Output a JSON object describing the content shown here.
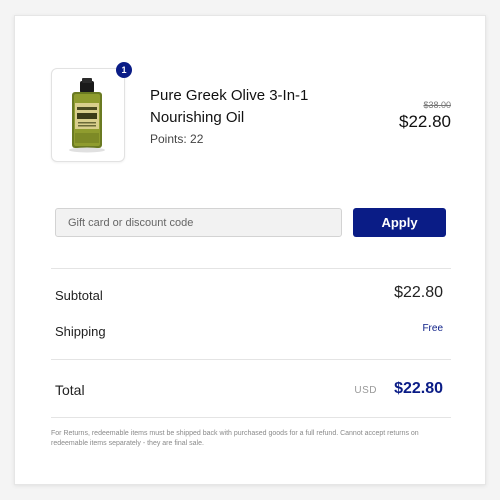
{
  "product": {
    "name": "Pure Greek Olive 3-In-1 Nourishing Oil",
    "points": "Points: 22",
    "quantity": "1",
    "original_price": "$38.00",
    "sale_price": "$22.80",
    "image_icon": "oil-bottle-icon"
  },
  "discount": {
    "placeholder": "Gift card or discount code",
    "value": "",
    "apply_label": "Apply"
  },
  "summary": {
    "subtotal_label": "Subtotal",
    "subtotal_value": "$22.80",
    "shipping_label": "Shipping",
    "shipping_value": "Free",
    "total_label": "Total",
    "currency": "USD",
    "total_value": "$22.80"
  },
  "footnote": "For Returns, redeemable items must be shipped back with purchased goods for a full refund. Cannot accept returns on redeemable items separately - they are final sale.",
  "colors": {
    "accent": "#0a1c86",
    "background": "#f4f4f4"
  }
}
